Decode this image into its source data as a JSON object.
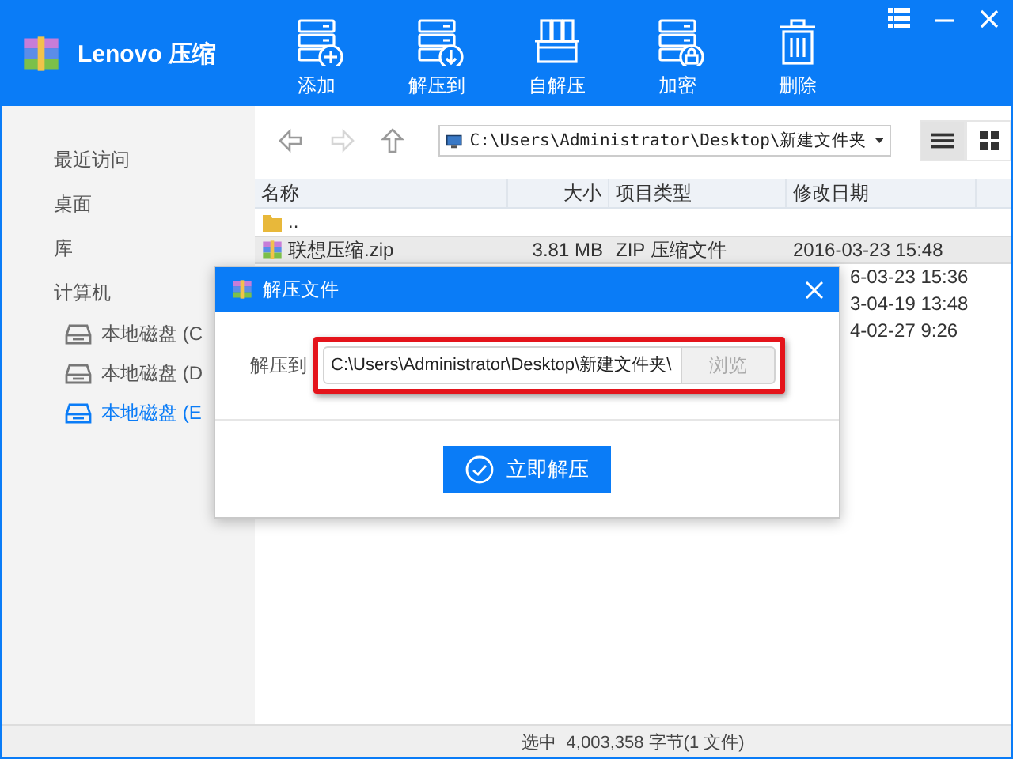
{
  "app": {
    "name": "Lenovo 压缩"
  },
  "toolbar": [
    {
      "label": "添加",
      "kind": "add"
    },
    {
      "label": "解压到",
      "kind": "extract"
    },
    {
      "label": "自解压",
      "kind": "sfx"
    },
    {
      "label": "加密",
      "kind": "lock"
    },
    {
      "label": "删除",
      "kind": "delete"
    }
  ],
  "sidebar": {
    "items": [
      {
        "label": "最近访问",
        "kind": "place",
        "selected": false
      },
      {
        "label": "桌面",
        "kind": "place",
        "selected": false
      },
      {
        "label": "库",
        "kind": "place",
        "selected": false
      },
      {
        "label": "计算机",
        "kind": "place",
        "selected": false
      },
      {
        "label": "本地磁盘 (C",
        "kind": "drive",
        "selected": false
      },
      {
        "label": "本地磁盘 (D",
        "kind": "drive",
        "selected": false
      },
      {
        "label": "本地磁盘 (E",
        "kind": "drive",
        "selected": true
      }
    ]
  },
  "nav": [
    {
      "kind": "back",
      "disabled": false
    },
    {
      "kind": "forward",
      "disabled": true
    },
    {
      "kind": "up",
      "disabled": false
    }
  ],
  "address": {
    "value": "C:\\Users\\Administrator\\Desktop\\新建文件夹"
  },
  "views": [
    {
      "kind": "list",
      "selected": true
    },
    {
      "kind": "grid",
      "selected": false
    }
  ],
  "table": {
    "columns": [
      "名称",
      "大小",
      "项目类型",
      "修改日期"
    ],
    "rows": [
      {
        "kind": "folder",
        "name": "..",
        "selected": false
      },
      {
        "kind": "zip",
        "name": "联想压缩.zip",
        "size": "3.81 MB",
        "type": "ZIP 压缩文件",
        "modified": "2016-03-23 15:48",
        "selected": true
      },
      {
        "kind": "covered",
        "modified": "6-03-23 15:36",
        "selected": false
      },
      {
        "kind": "covered",
        "modified": "3-04-19 13:48",
        "selected": false
      },
      {
        "kind": "covered",
        "modified": "4-02-27 9:26",
        "selected": false
      }
    ]
  },
  "dialog": {
    "title": "解压文件",
    "label": "解压到",
    "path": "C:\\Users\\Administrator\\Desktop\\新建文件夹\\",
    "browse": {
      "label": "浏览",
      "disabled": true
    },
    "submit": "立即解压",
    "highlighted": true
  },
  "status_bar": {
    "text": "选中  4,003,358 字节(1 文件)"
  }
}
